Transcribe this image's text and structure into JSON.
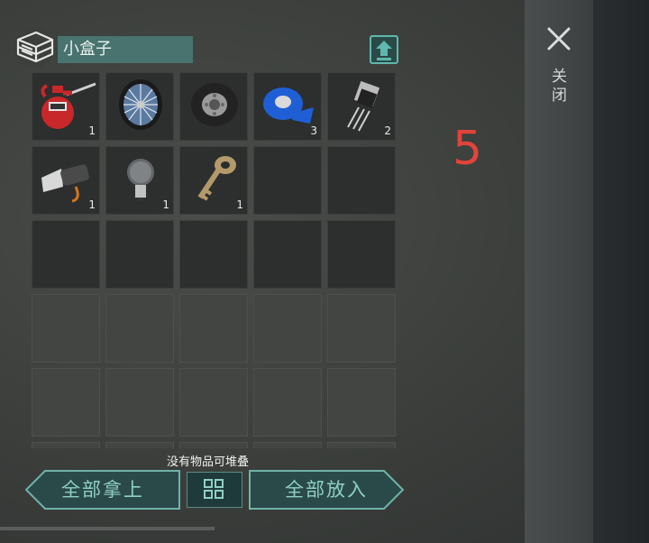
{
  "container": {
    "title": "小盒子",
    "icon": "box-stack-icon",
    "sort_icon": "sort-upload-icon"
  },
  "inventory": {
    "items": [
      {
        "name": "oil-can",
        "count": "1"
      },
      {
        "name": "wheel",
        "count": ""
      },
      {
        "name": "tire",
        "count": ""
      },
      {
        "name": "duct-tape",
        "count": "3"
      },
      {
        "name": "transistor",
        "count": "2"
      },
      {
        "name": "flashlight",
        "count": "1"
      },
      {
        "name": "light-bulb",
        "count": "1"
      },
      {
        "name": "key",
        "count": "1"
      }
    ]
  },
  "close": {
    "label": "关闭",
    "icon": "close-icon"
  },
  "timer": {
    "value": "5"
  },
  "footer": {
    "stack_hint": "没有物品可堆叠",
    "take_all_label": "全部拿上",
    "put_all_label": "全部放入",
    "stack_icon": "grid-stack-icon"
  },
  "colors": {
    "accent": "#49736e",
    "timer_red": "#e2433b",
    "button_text": "#8fd0c5"
  }
}
